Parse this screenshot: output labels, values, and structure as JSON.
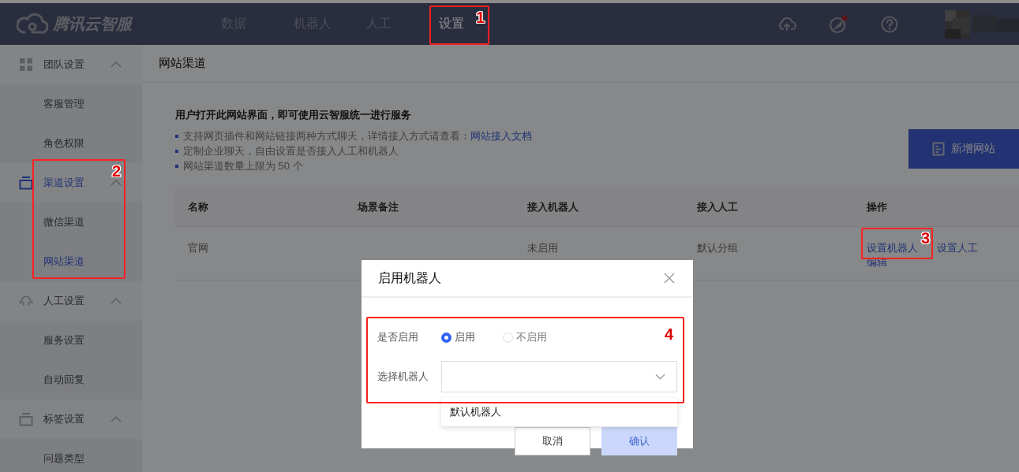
{
  "header": {
    "logo": "腾讯云智服",
    "nav": [
      {
        "label": "数据",
        "selected": false
      },
      {
        "label": "机器人",
        "selected": false
      },
      {
        "label": "人工",
        "selected": false
      },
      {
        "label": "设置",
        "selected": true,
        "callout": "1"
      }
    ],
    "notification_dot": true
  },
  "sidebar": {
    "groups": [
      {
        "label": "团队设置",
        "expanded": true,
        "selected": false,
        "children": [
          {
            "label": "客服管理",
            "selected": false
          },
          {
            "label": "角色权限",
            "selected": false
          }
        ]
      },
      {
        "label": "渠道设置",
        "expanded": true,
        "selected": true,
        "callout": "2",
        "children": [
          {
            "label": "微信渠道",
            "selected": false
          },
          {
            "label": "网站渠道",
            "selected": true
          }
        ]
      },
      {
        "label": "人工设置",
        "expanded": true,
        "selected": false,
        "children": [
          {
            "label": "服务设置",
            "selected": false
          },
          {
            "label": "自动回复",
            "selected": false
          }
        ]
      },
      {
        "label": "标签设置",
        "expanded": true,
        "selected": false,
        "children": [
          {
            "label": "问题类型",
            "selected": false
          }
        ]
      }
    ]
  },
  "page_title": "网站渠道",
  "intro": {
    "heading": "用户打开此网站界面，即可使用云智服统一进行服务",
    "bullets": [
      {
        "text": "支持网页插件和网站链接两种方式聊天，详情接入方式请查看：",
        "link": "网站接入文档"
      },
      {
        "text": "定制企业聊天，自由设置是否接入人工和机器人"
      },
      {
        "text": "网站渠道数量上限为 50 个"
      }
    ]
  },
  "add_button": "新增网站",
  "table": {
    "columns": [
      "名称",
      "场景备注",
      "接入机器人",
      "接入人工",
      "操作"
    ],
    "rows": [
      {
        "name": "官网",
        "robot": "未启用",
        "agent": "默认分组",
        "actions": [
          {
            "label": "设置机器人",
            "callout": "3"
          },
          {
            "label": "设置人工"
          },
          {
            "label": "编辑"
          }
        ]
      }
    ]
  },
  "dialog": {
    "title": "启用机器人",
    "callout": "4",
    "fields": [
      {
        "kind": "radio",
        "label": "是否启用",
        "options": [
          {
            "label": "启用",
            "selected": true
          },
          {
            "label": "不启用",
            "selected": false
          }
        ]
      },
      {
        "kind": "select",
        "label": "选择机器人",
        "expanded": true,
        "options": [
          "默认机器人"
        ]
      }
    ],
    "buttons": [
      {
        "label": "取消",
        "kind": "default",
        "disabled": false
      },
      {
        "label": "确认",
        "kind": "primary",
        "disabled": true
      }
    ]
  }
}
